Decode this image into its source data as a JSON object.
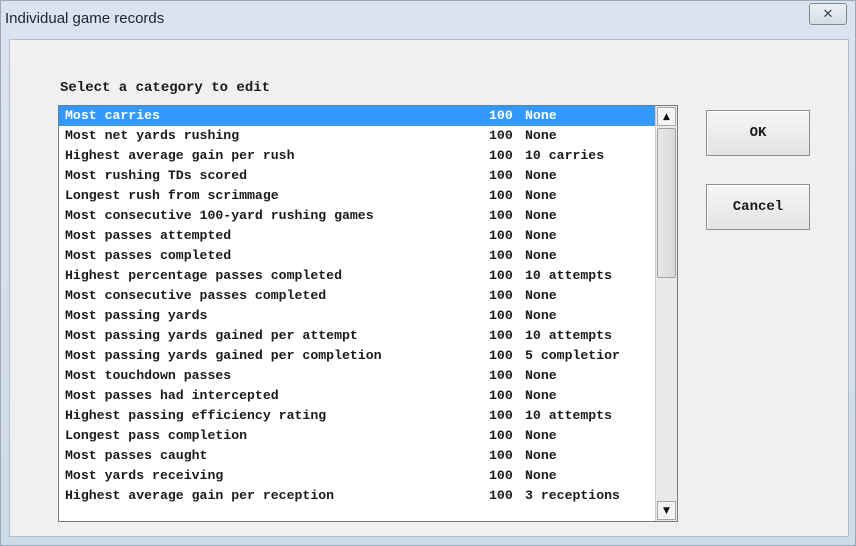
{
  "window": {
    "title": "Individual game records",
    "close_glyph": "✕"
  },
  "prompt": "Select a category to edit",
  "list": {
    "selected_index": 0,
    "items": [
      {
        "name": "Most carries",
        "value": "100",
        "minimum": "None"
      },
      {
        "name": "Most net yards rushing",
        "value": "100",
        "minimum": "None"
      },
      {
        "name": "Highest average gain per rush",
        "value": "100",
        "minimum": "10 carries"
      },
      {
        "name": "Most rushing TDs scored",
        "value": "100",
        "minimum": "None"
      },
      {
        "name": "Longest rush from scrimmage",
        "value": "100",
        "minimum": "None"
      },
      {
        "name": "Most consecutive 100-yard rushing games",
        "value": "100",
        "minimum": "None"
      },
      {
        "name": "Most passes attempted",
        "value": "100",
        "minimum": "None"
      },
      {
        "name": "Most passes completed",
        "value": "100",
        "minimum": "None"
      },
      {
        "name": "Highest percentage passes completed",
        "value": "100",
        "minimum": "10 attempts"
      },
      {
        "name": "Most consecutive passes completed",
        "value": "100",
        "minimum": "None"
      },
      {
        "name": "Most passing yards",
        "value": "100",
        "minimum": "None"
      },
      {
        "name": "Most passing yards gained per attempt",
        "value": "100",
        "minimum": "10 attempts"
      },
      {
        "name": "Most passing yards gained per completion",
        "value": "100",
        "minimum": "5 completior"
      },
      {
        "name": "Most touchdown passes",
        "value": "100",
        "minimum": "None"
      },
      {
        "name": "Most passes had intercepted",
        "value": "100",
        "minimum": "None"
      },
      {
        "name": "Highest passing efficiency rating",
        "value": "100",
        "minimum": "10 attempts"
      },
      {
        "name": "Longest pass completion",
        "value": "100",
        "minimum": "None"
      },
      {
        "name": "Most passes caught",
        "value": "100",
        "minimum": "None"
      },
      {
        "name": "Most yards receiving",
        "value": "100",
        "minimum": "None"
      },
      {
        "name": "Highest average gain per reception",
        "value": "100",
        "minimum": "3 receptions"
      }
    ],
    "scroll_up_glyph": "▲",
    "scroll_down_glyph": "▼"
  },
  "buttons": {
    "ok_label": "OK",
    "cancel_label": "Cancel"
  },
  "colors": {
    "selection": "#3399ff"
  },
  "icons": {
    "close": "close-icon",
    "scroll_up": "scroll-up-arrow-icon",
    "scroll_down": "scroll-down-arrow-icon"
  }
}
